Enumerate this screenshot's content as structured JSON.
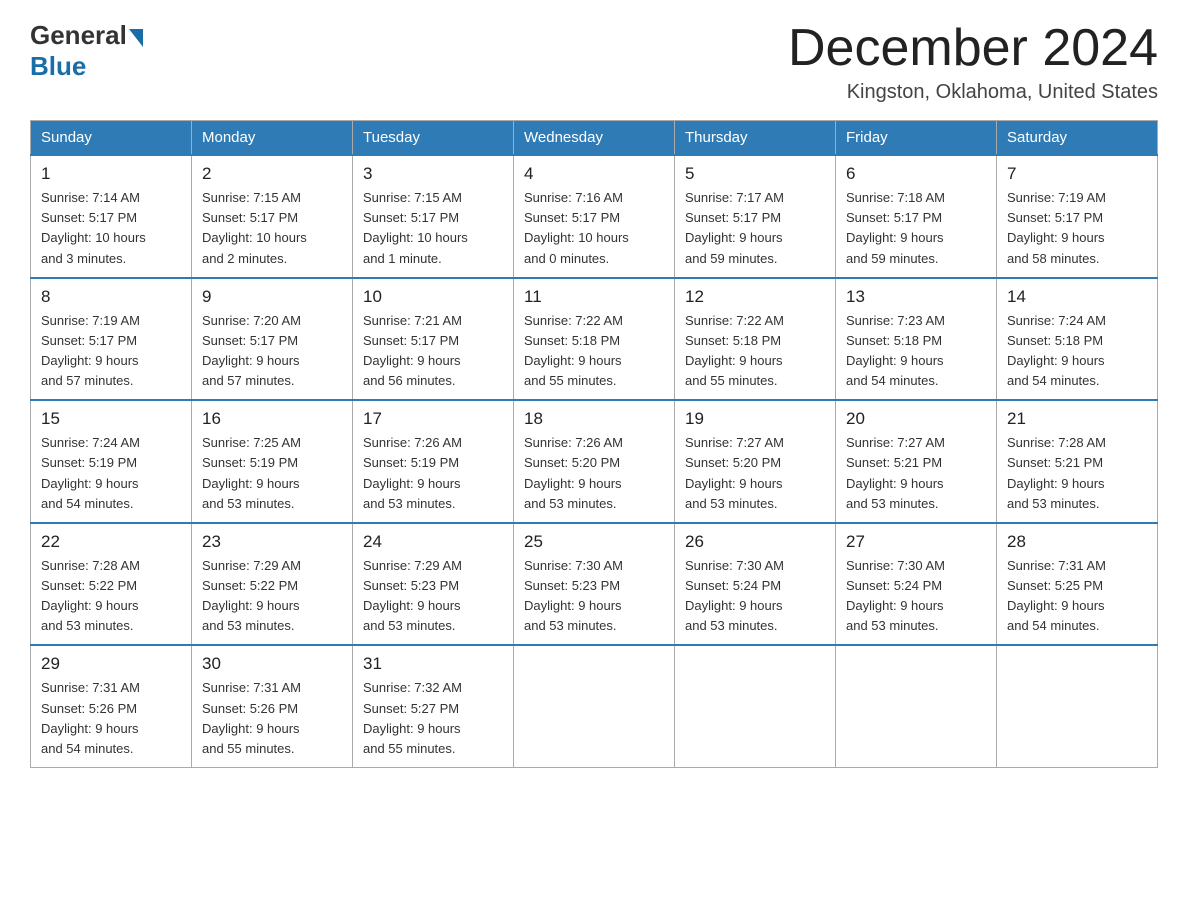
{
  "header": {
    "logo_general": "General",
    "logo_blue": "Blue",
    "month_title": "December 2024",
    "location": "Kingston, Oklahoma, United States"
  },
  "days_of_week": [
    "Sunday",
    "Monday",
    "Tuesday",
    "Wednesday",
    "Thursday",
    "Friday",
    "Saturday"
  ],
  "weeks": [
    [
      {
        "day": "1",
        "info": "Sunrise: 7:14 AM\nSunset: 5:17 PM\nDaylight: 10 hours\nand 3 minutes."
      },
      {
        "day": "2",
        "info": "Sunrise: 7:15 AM\nSunset: 5:17 PM\nDaylight: 10 hours\nand 2 minutes."
      },
      {
        "day": "3",
        "info": "Sunrise: 7:15 AM\nSunset: 5:17 PM\nDaylight: 10 hours\nand 1 minute."
      },
      {
        "day": "4",
        "info": "Sunrise: 7:16 AM\nSunset: 5:17 PM\nDaylight: 10 hours\nand 0 minutes."
      },
      {
        "day": "5",
        "info": "Sunrise: 7:17 AM\nSunset: 5:17 PM\nDaylight: 9 hours\nand 59 minutes."
      },
      {
        "day": "6",
        "info": "Sunrise: 7:18 AM\nSunset: 5:17 PM\nDaylight: 9 hours\nand 59 minutes."
      },
      {
        "day": "7",
        "info": "Sunrise: 7:19 AM\nSunset: 5:17 PM\nDaylight: 9 hours\nand 58 minutes."
      }
    ],
    [
      {
        "day": "8",
        "info": "Sunrise: 7:19 AM\nSunset: 5:17 PM\nDaylight: 9 hours\nand 57 minutes."
      },
      {
        "day": "9",
        "info": "Sunrise: 7:20 AM\nSunset: 5:17 PM\nDaylight: 9 hours\nand 57 minutes."
      },
      {
        "day": "10",
        "info": "Sunrise: 7:21 AM\nSunset: 5:17 PM\nDaylight: 9 hours\nand 56 minutes."
      },
      {
        "day": "11",
        "info": "Sunrise: 7:22 AM\nSunset: 5:18 PM\nDaylight: 9 hours\nand 55 minutes."
      },
      {
        "day": "12",
        "info": "Sunrise: 7:22 AM\nSunset: 5:18 PM\nDaylight: 9 hours\nand 55 minutes."
      },
      {
        "day": "13",
        "info": "Sunrise: 7:23 AM\nSunset: 5:18 PM\nDaylight: 9 hours\nand 54 minutes."
      },
      {
        "day": "14",
        "info": "Sunrise: 7:24 AM\nSunset: 5:18 PM\nDaylight: 9 hours\nand 54 minutes."
      }
    ],
    [
      {
        "day": "15",
        "info": "Sunrise: 7:24 AM\nSunset: 5:19 PM\nDaylight: 9 hours\nand 54 minutes."
      },
      {
        "day": "16",
        "info": "Sunrise: 7:25 AM\nSunset: 5:19 PM\nDaylight: 9 hours\nand 53 minutes."
      },
      {
        "day": "17",
        "info": "Sunrise: 7:26 AM\nSunset: 5:19 PM\nDaylight: 9 hours\nand 53 minutes."
      },
      {
        "day": "18",
        "info": "Sunrise: 7:26 AM\nSunset: 5:20 PM\nDaylight: 9 hours\nand 53 minutes."
      },
      {
        "day": "19",
        "info": "Sunrise: 7:27 AM\nSunset: 5:20 PM\nDaylight: 9 hours\nand 53 minutes."
      },
      {
        "day": "20",
        "info": "Sunrise: 7:27 AM\nSunset: 5:21 PM\nDaylight: 9 hours\nand 53 minutes."
      },
      {
        "day": "21",
        "info": "Sunrise: 7:28 AM\nSunset: 5:21 PM\nDaylight: 9 hours\nand 53 minutes."
      }
    ],
    [
      {
        "day": "22",
        "info": "Sunrise: 7:28 AM\nSunset: 5:22 PM\nDaylight: 9 hours\nand 53 minutes."
      },
      {
        "day": "23",
        "info": "Sunrise: 7:29 AM\nSunset: 5:22 PM\nDaylight: 9 hours\nand 53 minutes."
      },
      {
        "day": "24",
        "info": "Sunrise: 7:29 AM\nSunset: 5:23 PM\nDaylight: 9 hours\nand 53 minutes."
      },
      {
        "day": "25",
        "info": "Sunrise: 7:30 AM\nSunset: 5:23 PM\nDaylight: 9 hours\nand 53 minutes."
      },
      {
        "day": "26",
        "info": "Sunrise: 7:30 AM\nSunset: 5:24 PM\nDaylight: 9 hours\nand 53 minutes."
      },
      {
        "day": "27",
        "info": "Sunrise: 7:30 AM\nSunset: 5:24 PM\nDaylight: 9 hours\nand 53 minutes."
      },
      {
        "day": "28",
        "info": "Sunrise: 7:31 AM\nSunset: 5:25 PM\nDaylight: 9 hours\nand 54 minutes."
      }
    ],
    [
      {
        "day": "29",
        "info": "Sunrise: 7:31 AM\nSunset: 5:26 PM\nDaylight: 9 hours\nand 54 minutes."
      },
      {
        "day": "30",
        "info": "Sunrise: 7:31 AM\nSunset: 5:26 PM\nDaylight: 9 hours\nand 55 minutes."
      },
      {
        "day": "31",
        "info": "Sunrise: 7:32 AM\nSunset: 5:27 PM\nDaylight: 9 hours\nand 55 minutes."
      },
      null,
      null,
      null,
      null
    ]
  ]
}
